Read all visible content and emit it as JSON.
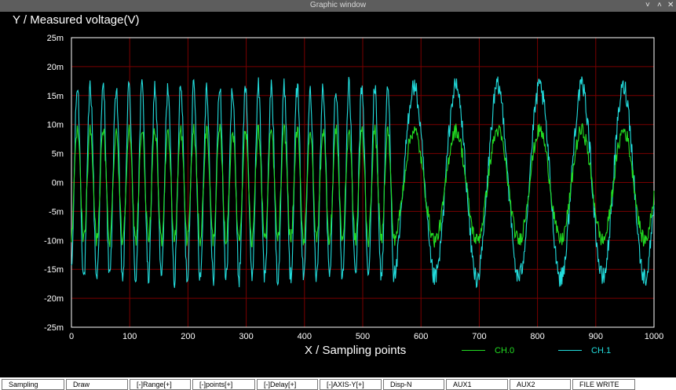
{
  "window": {
    "title": "Graphic window",
    "controls": [
      "˅",
      "˄",
      "✕"
    ]
  },
  "chart_data": {
    "type": "line",
    "ylabel": "Y / Measured voltage(V)",
    "xlabel": "X / Sampling points",
    "xlim": [
      0,
      1000
    ],
    "ylim": [
      -25,
      25
    ],
    "x_ticks": [
      0,
      100,
      200,
      300,
      400,
      500,
      600,
      700,
      800,
      900,
      1000
    ],
    "x_tick_labels": [
      "0",
      "100",
      "200",
      "300",
      "400",
      "500",
      "600",
      "700",
      "800",
      "900",
      "1000"
    ],
    "y_ticks": [
      25,
      20,
      15,
      10,
      5,
      0,
      -5,
      -10,
      -15,
      -20,
      -25
    ],
    "y_tick_labels": [
      "25m",
      "20m",
      "15m",
      "10m",
      "5m",
      "0m",
      "-5m",
      "-10m",
      "-15m",
      "-20m",
      "-25m"
    ],
    "grid": true,
    "legend_placement": "bottom-right",
    "series": [
      {
        "name": "CH.0",
        "color": "#22dd22"
      },
      {
        "name": "CH.1",
        "color": "#22dddd"
      }
    ],
    "signal_segments": [
      {
        "x_start": 0,
        "x_end": 555,
        "period": 22.2
      },
      {
        "x_start": 555,
        "x_end": 1000,
        "period": 72
      }
    ],
    "amplitudes_mV": {
      "CH.0": 9.5,
      "CH.1": 16.5
    },
    "offsets_mV": {
      "CH.0": -0.5,
      "CH.1": 0
    },
    "noise_mV": {
      "CH.0": 1.3,
      "CH.1": 1.8
    }
  },
  "toolbar": [
    {
      "label": "Sampling"
    },
    {
      "label": "Draw"
    },
    {
      "label": "[-]Range[+]"
    },
    {
      "label": "[-]points[+]"
    },
    {
      "label": "[-]Delay[+]"
    },
    {
      "label": "[-]AXIS-Y[+]"
    },
    {
      "label": "Disp-N"
    },
    {
      "label": "AUX1"
    },
    {
      "label": "AUX2"
    },
    {
      "label": "FILE WRITE"
    }
  ]
}
